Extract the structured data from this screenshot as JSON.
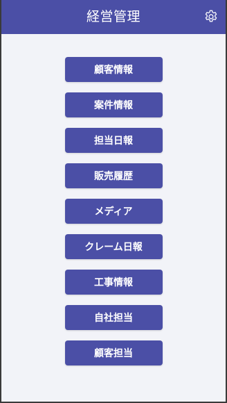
{
  "header": {
    "title": "経営管理",
    "settings_icon": "gear-icon"
  },
  "menu": {
    "items": [
      {
        "label": "顧客情報"
      },
      {
        "label": "案件情報"
      },
      {
        "label": "担当日報"
      },
      {
        "label": "販売履歴"
      },
      {
        "label": "メディア"
      },
      {
        "label": "クレーム日報"
      },
      {
        "label": "工事情報"
      },
      {
        "label": "自社担当"
      },
      {
        "label": "顧客担当"
      }
    ]
  },
  "colors": {
    "primary": "#4b4fa6",
    "background": "#f2f3f8",
    "text_on_primary": "#ffffff"
  }
}
